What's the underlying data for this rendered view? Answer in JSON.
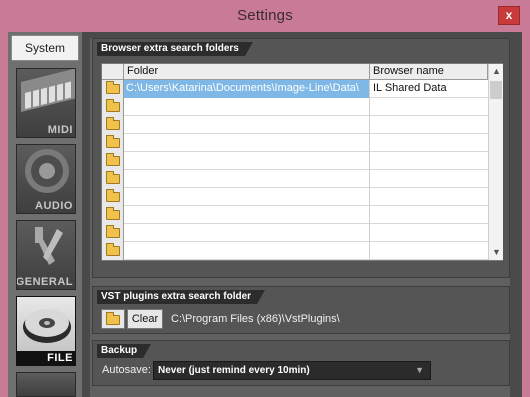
{
  "window": {
    "title": "Settings",
    "close_glyph": "x"
  },
  "sidebar": {
    "system_tab": "System",
    "categories": [
      {
        "label": "MIDI",
        "icon": "midi-keyboard-icon"
      },
      {
        "label": "AUDIO",
        "icon": "speaker-icon"
      },
      {
        "label": "GENERAL",
        "icon": "tools-icon"
      },
      {
        "label": "FILE",
        "icon": "disk-icon",
        "active": true
      }
    ]
  },
  "browser_group": {
    "title": "Browser extra search folders",
    "columns": {
      "folder": "Folder",
      "name": "Browser name"
    },
    "rows": [
      {
        "folder": "C:\\Users\\Katarina\\Documents\\Image-Line\\Data\\",
        "name": "IL Shared Data",
        "selected": true
      },
      {
        "folder": "",
        "name": ""
      },
      {
        "folder": "",
        "name": ""
      },
      {
        "folder": "",
        "name": ""
      },
      {
        "folder": "",
        "name": ""
      },
      {
        "folder": "",
        "name": ""
      },
      {
        "folder": "",
        "name": ""
      },
      {
        "folder": "",
        "name": ""
      },
      {
        "folder": "",
        "name": ""
      },
      {
        "folder": "",
        "name": ""
      }
    ]
  },
  "vst_group": {
    "title": "VST plugins extra search folder",
    "clear_label": "Clear",
    "path": "C:\\Program Files (x86)\\VstPlugins\\"
  },
  "backup_group": {
    "title": "Backup",
    "autosave_label": "Autosave:",
    "autosave_value": "Never (just remind every 10min)"
  },
  "colors": {
    "accent_pink": "#c97a96",
    "selection_blue": "#7fb8e6",
    "close_red": "#c93b3b"
  }
}
